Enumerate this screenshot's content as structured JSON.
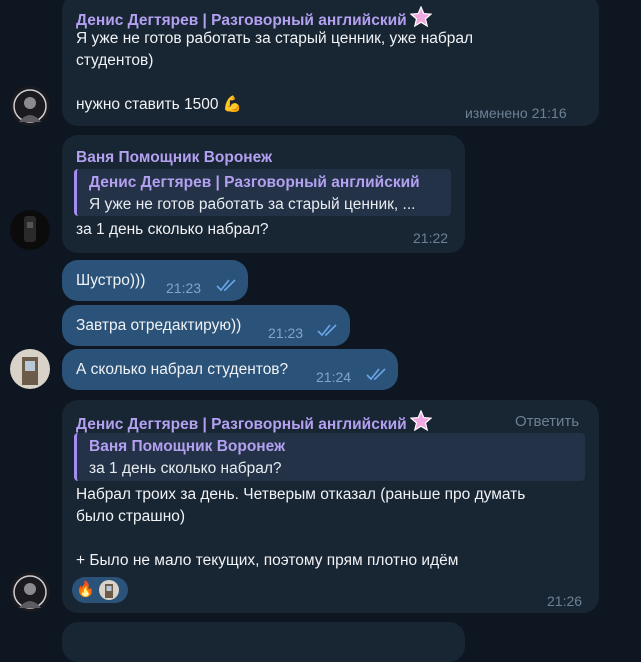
{
  "messages": [
    {
      "sender": "Денис Дегтярев | Разговорный английский",
      "lines": [
        "Я уже не готов работать за старый ценник, уже набрал",
        "студентов)",
        "",
        "нужно ставить 1500"
      ],
      "emoji": "💪",
      "time": "изменено 21:16"
    },
    {
      "sender": "Ваня Помощник Воронеж",
      "quote_name": "Денис Дегтярев | Разговорный английский",
      "quote_text": "Я уже не готов работать за старый ценник, ...",
      "text": "за 1 день сколько набрал?",
      "time": "21:22"
    },
    {
      "text": "Шустро)))",
      "time": "21:23"
    },
    {
      "text": "Завтра отредактирую))",
      "time": "21:23"
    },
    {
      "text": "А сколько набрал студентов?",
      "time": "21:24"
    },
    {
      "sender": "Денис Дегтярев | Разговорный английский",
      "reply_label": "Ответить",
      "quote_name": "Ваня Помощник Воронеж",
      "quote_text": "за 1 день сколько набрал?",
      "lines": [
        "Набрал троих за день. Четверым отказал (раньше про думать",
        "было страшно)",
        "",
        "+ Было не мало текущих, поэтому прям плотно идём"
      ],
      "reactions": [
        "🔥"
      ],
      "time": "21:26"
    }
  ],
  "colors": {
    "background": "#0e1621",
    "incoming": "#182533",
    "outgoing": "#2b5278",
    "name": "#b3a0f0"
  }
}
